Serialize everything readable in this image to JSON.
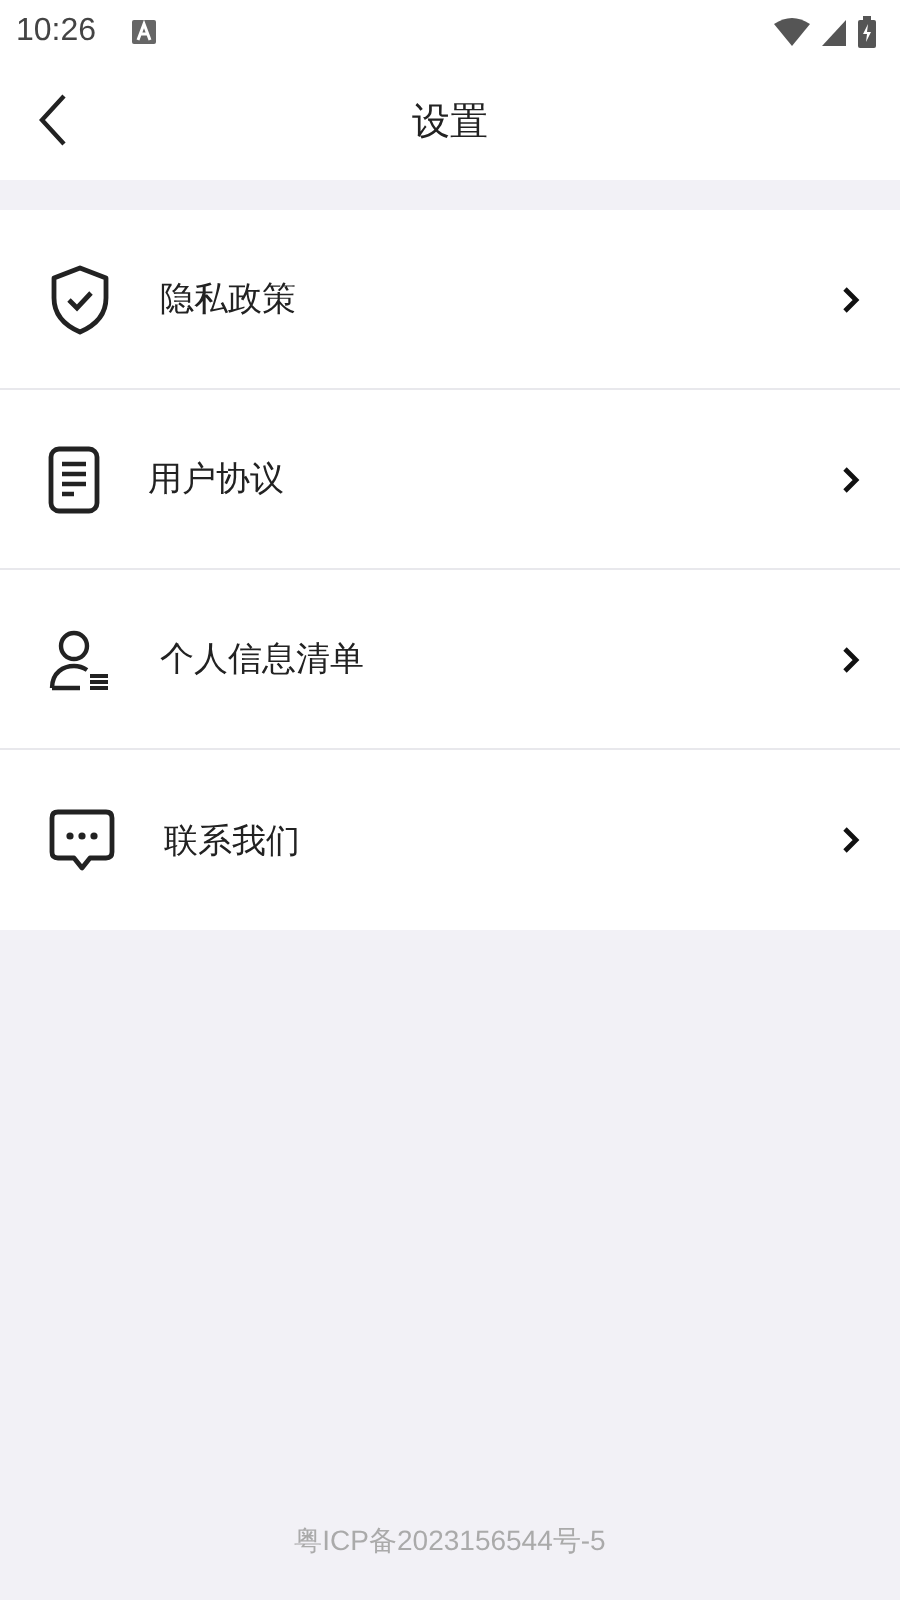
{
  "status_bar": {
    "time": "10:26"
  },
  "header": {
    "title": "设置"
  },
  "menu": [
    {
      "label": "隐私政策"
    },
    {
      "label": "用户协议"
    },
    {
      "label": "个人信息清单"
    },
    {
      "label": "联系我们"
    }
  ],
  "footer": {
    "icp": "粤ICP备2023156544号-5"
  }
}
